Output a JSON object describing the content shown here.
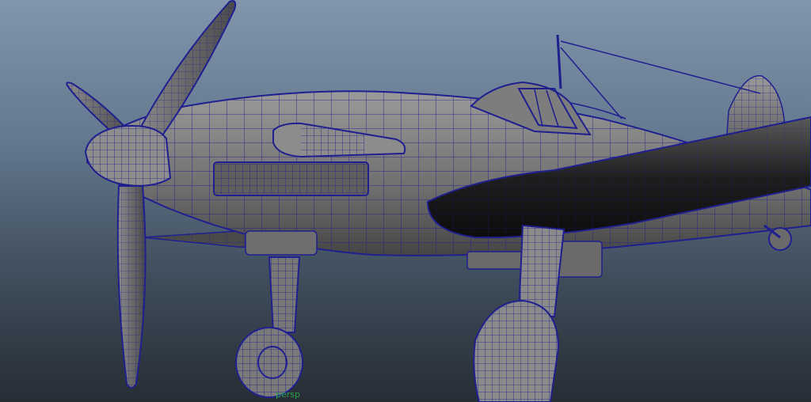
{
  "viewport": {
    "camera_label": "persp",
    "background_top": "#8195ad",
    "background_bottom": "#262d35",
    "wire_color": "#1f1f8f",
    "mesh_color": "#6b6b6b",
    "camera_label_color": "#2fa34a"
  },
  "model": {
    "shading": "wireframe-on-shaded",
    "subject": "propeller-aircraft-icon"
  }
}
